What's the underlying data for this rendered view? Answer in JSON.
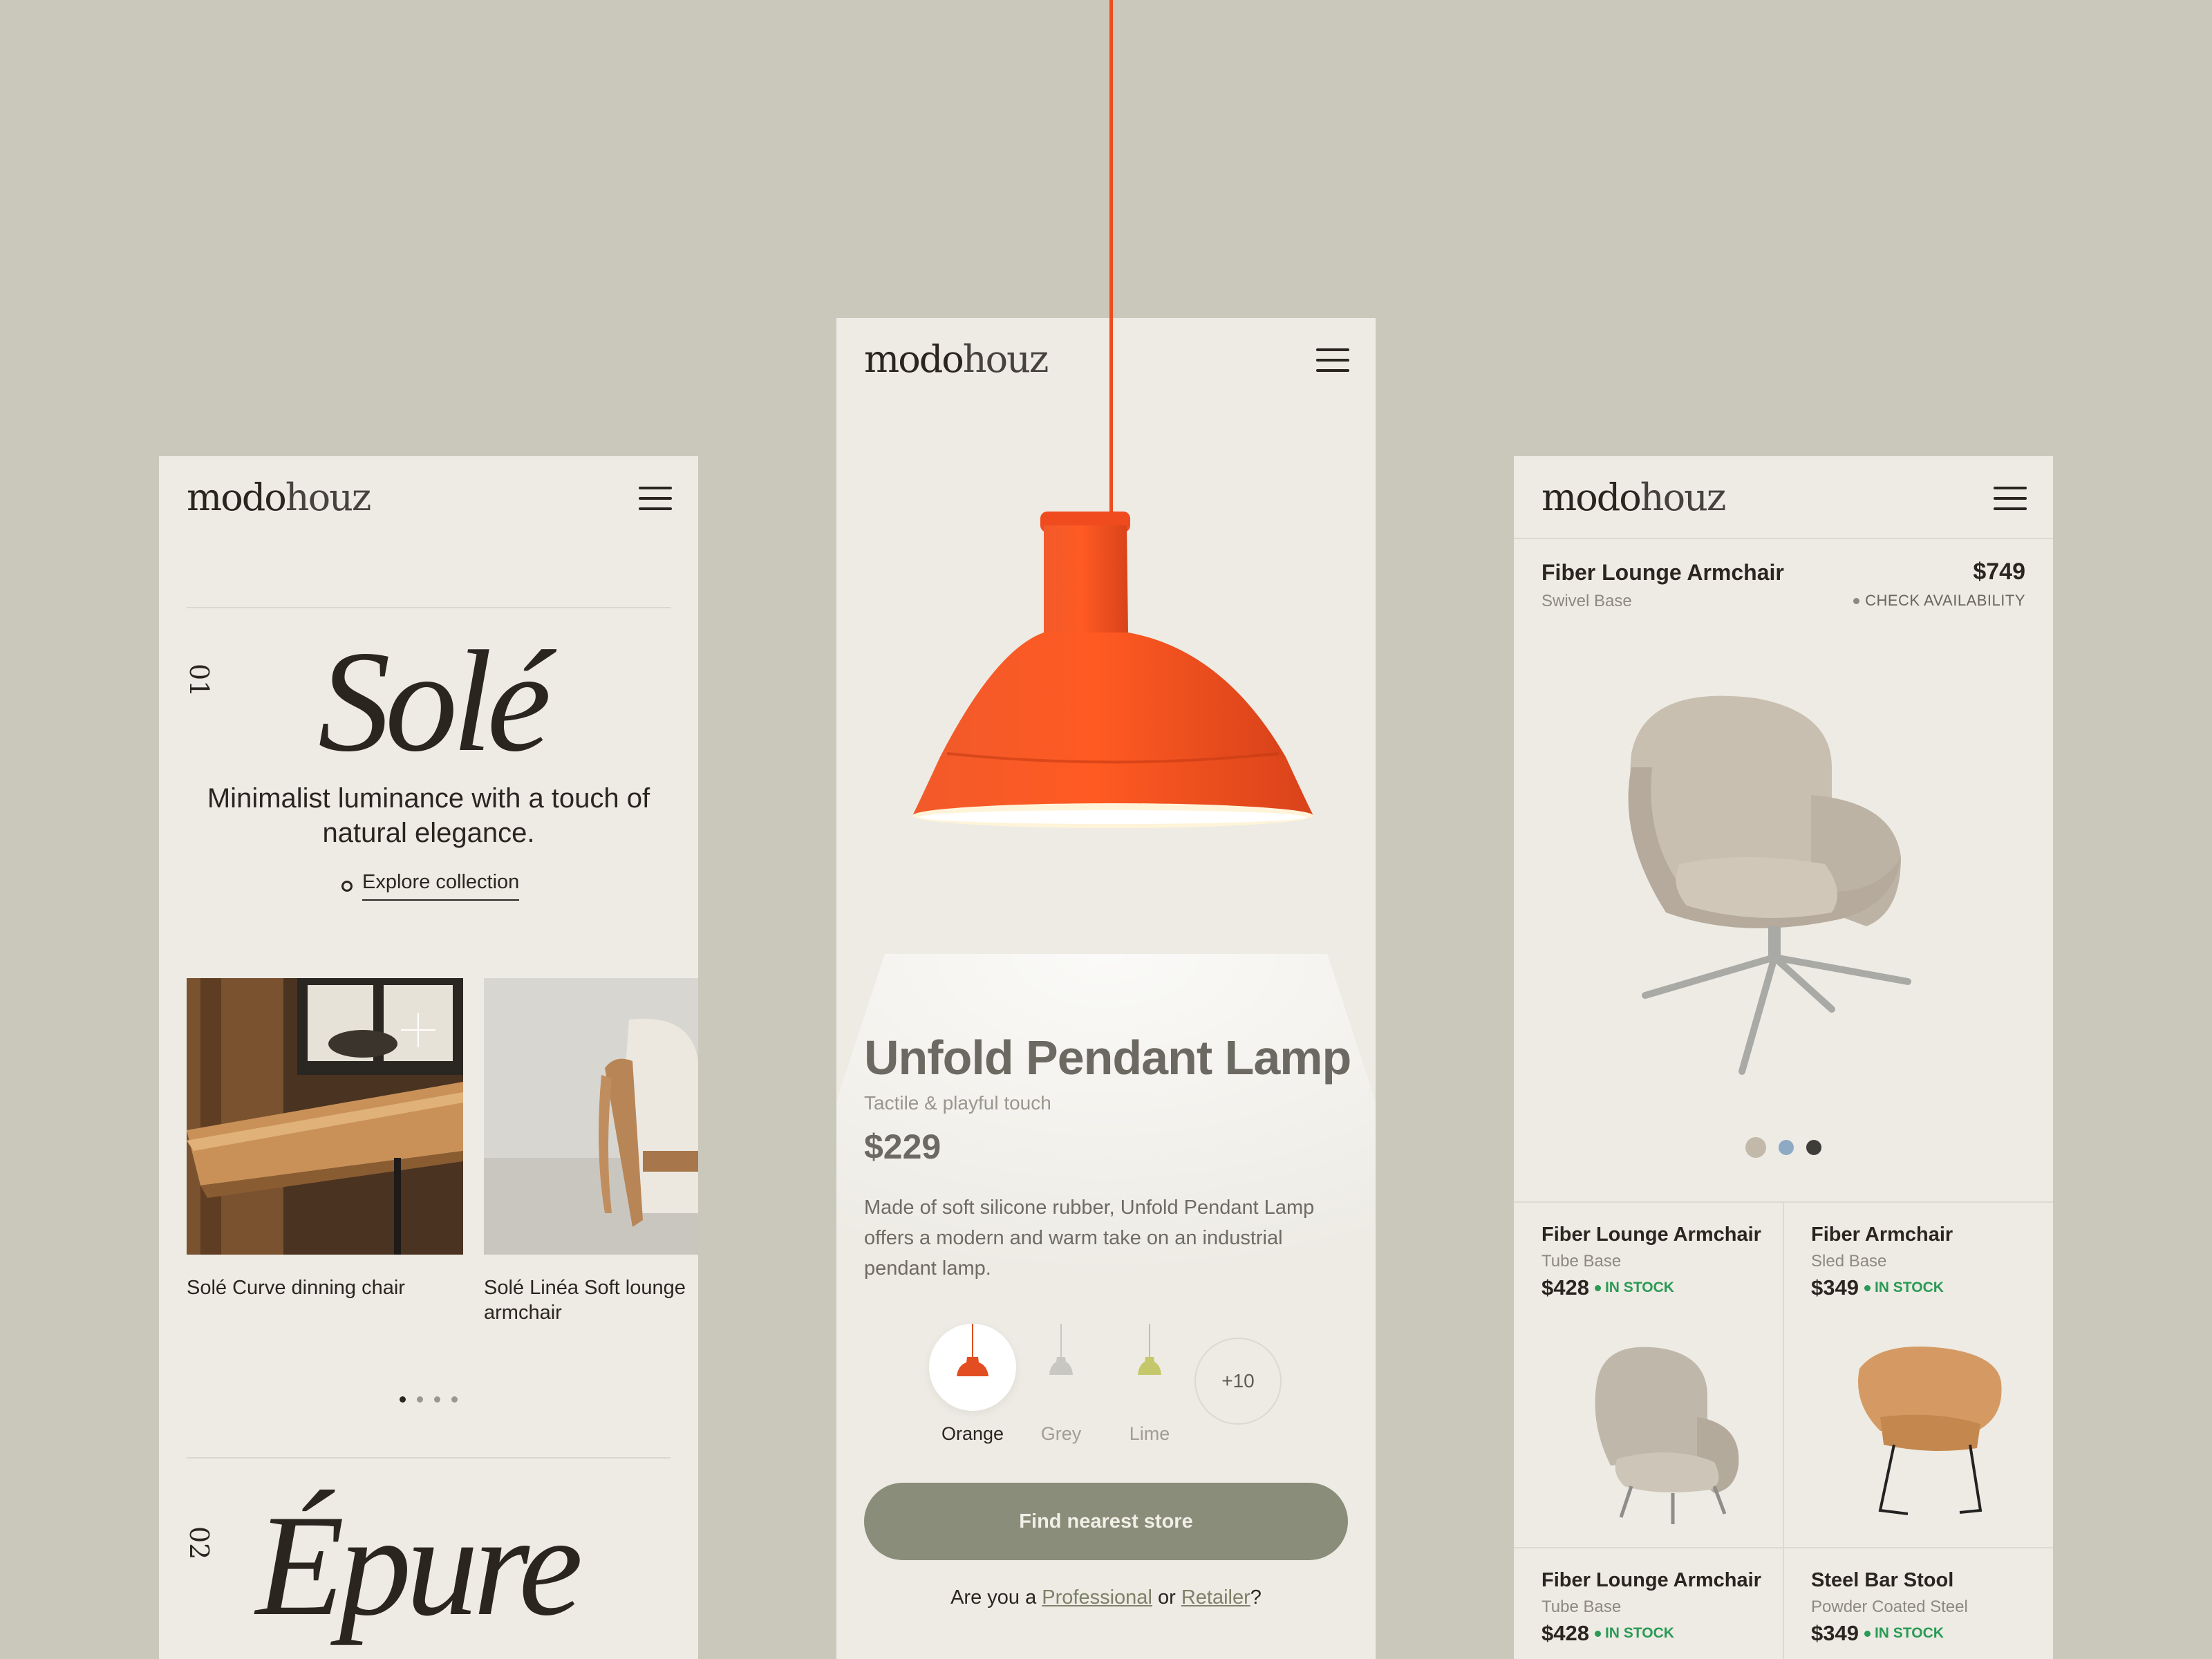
{
  "brand": {
    "logo_bold": "modo",
    "logo_light": "houz"
  },
  "left": {
    "section1_number": "01",
    "section1_title": "Solé",
    "tagline": "Minimalist luminance with a touch of natural elegance.",
    "explore_label": "Explore collection",
    "cards": [
      {
        "caption": "Solé Curve dinning chair"
      },
      {
        "caption": "Solé Linéa Soft lounge armchair"
      }
    ],
    "carousel": {
      "count": 4,
      "active": 1
    },
    "section2_number": "02",
    "section2_title": "Épure"
  },
  "center": {
    "title": "Unfold Pendant Lamp",
    "subtitle": "Tactile & playful touch",
    "price": "$229",
    "description": "Made of soft silicone rubber, Unfold Pendant Lamp offers a modern and warm take on an industrial pendant lamp.",
    "swatches": [
      {
        "name": "Orange",
        "color": "#e24e22",
        "active": true
      },
      {
        "name": "Grey",
        "color": "#c9c7c2",
        "active": false
      },
      {
        "name": "Lime",
        "color": "#c5c86a",
        "active": false
      }
    ],
    "more_swatches": "+10",
    "cta": "Find nearest store",
    "pro_prefix": "Are you a",
    "pro_link": "Professional",
    "pro_or": "or",
    "retailer_link": "Retailer",
    "pro_suffix": "?"
  },
  "right": {
    "featured": {
      "name": "Fiber Lounge Armchair",
      "price": "$749",
      "base": "Swivel Base",
      "availability": "CHECK AVAILABILITY"
    },
    "color_options": [
      "#c3b9aa",
      "#8ea9c4",
      "#3e3d3a"
    ],
    "products": [
      {
        "name": "Fiber Lounge Armchair",
        "base": "Tube Base",
        "price": "$428",
        "stock": "IN STOCK"
      },
      {
        "name": "Fiber Armchair",
        "base": "Sled Base",
        "price": "$349",
        "stock": "IN STOCK"
      },
      {
        "name": "Fiber Lounge Armchair",
        "base": "Tube Base",
        "price": "$428",
        "stock": "IN STOCK"
      },
      {
        "name": "Steel Bar Stool",
        "base": "Powder Coated Steel",
        "price": "$349",
        "stock": "IN STOCK"
      }
    ]
  },
  "colors": {
    "background": "#c9c8bb",
    "panel": "#edebe4",
    "lamp_orange": "#f04b1e",
    "cta_green": "#8a8d79",
    "stock_green": "#2a9a55"
  }
}
